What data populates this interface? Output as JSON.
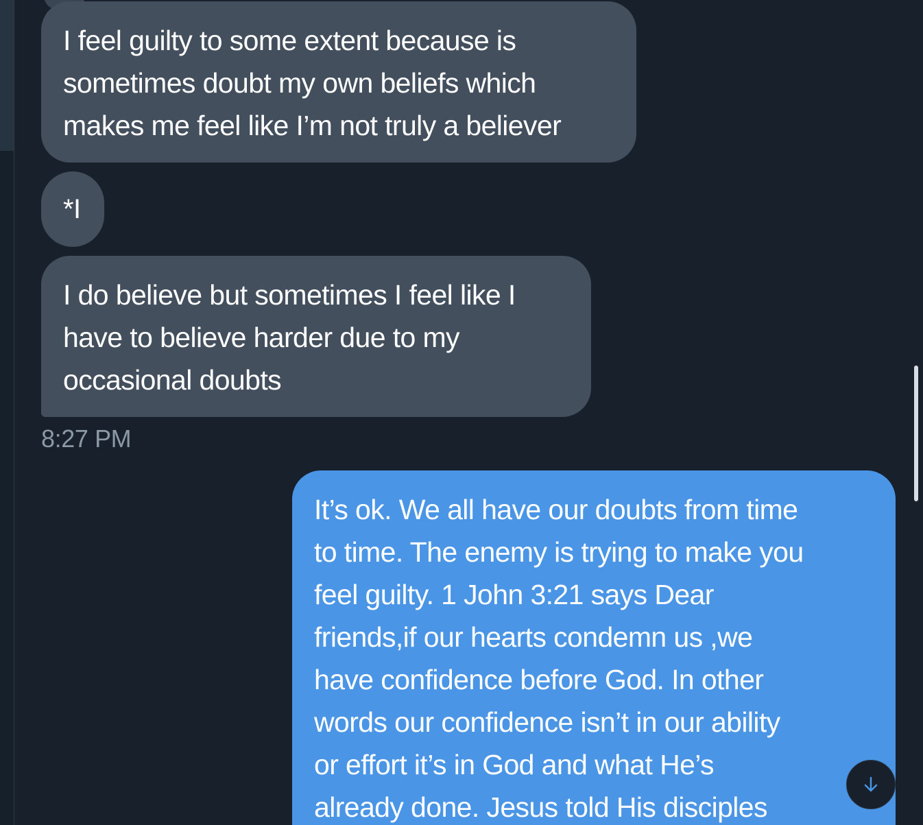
{
  "conversation": {
    "messages": [
      {
        "direction": "received",
        "text": "I feel guilty to some extent because is\nsometimes doubt my own beliefs which\nmakes me feel like I’m not truly a believer"
      },
      {
        "direction": "received",
        "text": "*I"
      },
      {
        "direction": "received",
        "text": "I do believe but sometimes I feel like I\nhave to believe harder due to my\noccasional doubts"
      },
      {
        "direction": "sent",
        "text": "It’s ok. We all have our doubts from time\nto time. The enemy is trying to make you\nfeel guilty. 1 John 3:21 says Dear\nfriends,if our hearts condemn us ,we\nhave confidence before God. In other\nwords our confidence isn’t in our ability\nor effort it’s in God and what He’s\nalready done. Jesus told His disciples"
      }
    ],
    "timestamp": "8:27 PM"
  },
  "controls": {
    "scroll_to_bottom_icon": "arrow-down-icon"
  },
  "colors": {
    "received_bubble": "#434f5d",
    "sent_bubble": "#4a95e6",
    "background": "#17202b",
    "timestamp": "#8b98a5",
    "accent": "#4a95e6"
  }
}
